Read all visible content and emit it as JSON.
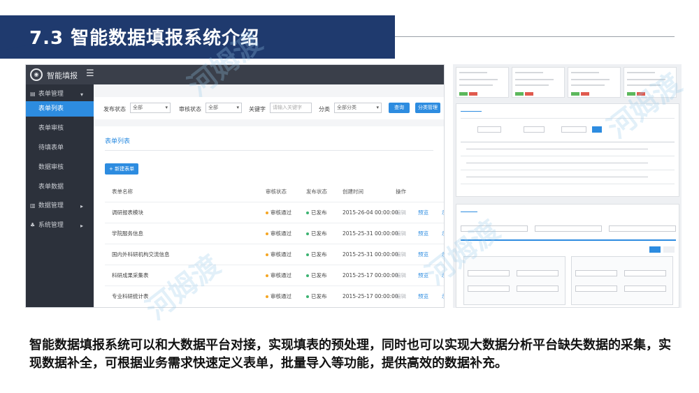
{
  "slide": {
    "title": "7.3   智能数据填报系统介绍",
    "description": "智能数据填报系统可以和大数据平台对接，实现填表的预处理，同时也可以实现大数据分析平台缺失数据的采集，实现数据补全，可根据业务需求快速定义表单，批量导入等功能，提供高效的数据补充。",
    "watermark": "河姆渡"
  },
  "app": {
    "name": "智能填报",
    "menu_icon": "☰",
    "sidebar": {
      "groups": [
        {
          "icon": "form-icon",
          "label": "表单管理"
        },
        {
          "icon": "chart-icon",
          "label": "数据管理"
        },
        {
          "icon": "tree-icon",
          "label": "系统管理"
        }
      ],
      "items": [
        "表单列表",
        "表单审核",
        "待填表单",
        "数据审核",
        "表单数据"
      ]
    },
    "filters": {
      "publish_label": "发布状态",
      "publish_value": "全部",
      "review_label": "审核状态",
      "review_value": "全部",
      "keyword_label": "关键字",
      "keyword_placeholder": "请输入关键字",
      "category_label": "分类",
      "category_value": "全部分类",
      "search_btn": "查询",
      "category_btn": "分类管理"
    },
    "list": {
      "title": "表单列表",
      "add_btn": "+ 新建表单",
      "headers": [
        "表单名称",
        "审核状态",
        "发布状态",
        "创建时间",
        "操作"
      ],
      "rows": [
        {
          "name": "调研报表模块",
          "review": "审核通过",
          "publish": "已发布",
          "time": "2015-26-04 00:00:00",
          "edit": "编辑",
          "preview": "预览",
          "more": "示"
        },
        {
          "name": "学院服务信息",
          "review": "审核通过",
          "publish": "已发布",
          "time": "2015-25-31 00:00:00",
          "edit": "编辑",
          "preview": "预览",
          "more": "示"
        },
        {
          "name": "国内外科研机构交流信息",
          "review": "审核通过",
          "publish": "已发布",
          "time": "2015-25-31 00:00:00",
          "edit": "编辑",
          "preview": "预览",
          "more": "示"
        },
        {
          "name": "科研成果采集表",
          "review": "审核通过",
          "publish": "已发布",
          "time": "2015-25-17 00:00:00",
          "edit": "编辑",
          "preview": "预览",
          "more": "示"
        },
        {
          "name": "专业科研统计表",
          "review": "审核通过",
          "publish": "已发布",
          "time": "2015-25-17 00:00:00",
          "edit": "编辑",
          "preview": "预览",
          "more": "示"
        }
      ]
    }
  }
}
